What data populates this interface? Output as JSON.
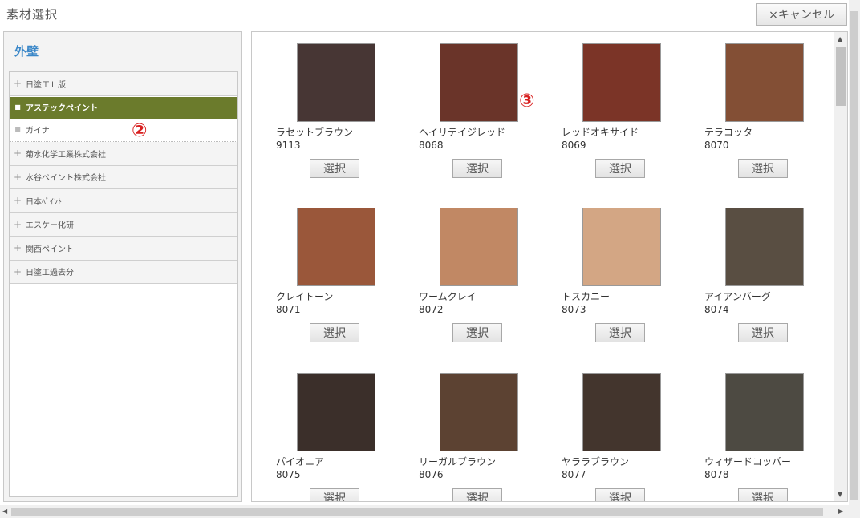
{
  "dialog": {
    "title": "素材選択",
    "cancel_label": "×キャンセル"
  },
  "sidebar": {
    "heading": "外壁",
    "items": [
      {
        "label": "日塗工Ｌ版",
        "marker": "+",
        "state": "collapsed"
      },
      {
        "label": "アステックペイント",
        "marker": "■",
        "state": "active"
      },
      {
        "label": "ガイナ",
        "marker": "■",
        "state": "sub"
      },
      {
        "label": "菊水化学工業株式会社",
        "marker": "+",
        "state": "collapsed"
      },
      {
        "label": "水谷ペイント株式会社",
        "marker": "+",
        "state": "collapsed"
      },
      {
        "label": "日本ﾍﾟｲﾝﾄ",
        "marker": "+",
        "state": "collapsed"
      },
      {
        "label": "エスケー化研",
        "marker": "+",
        "state": "collapsed"
      },
      {
        "label": "関西ペイント",
        "marker": "+",
        "state": "collapsed"
      },
      {
        "label": "日塗工過去分",
        "marker": "+",
        "state": "collapsed"
      }
    ]
  },
  "annotations": {
    "marker_2": "②",
    "marker_3": "③"
  },
  "select_label": "選択",
  "materials": [
    {
      "name": "ラセットブラウン",
      "code": "9113",
      "color": "#473634"
    },
    {
      "name": "ヘイリテイジレッド",
      "code": "8068",
      "color": "#6a3429"
    },
    {
      "name": "レッドオキサイド",
      "code": "8069",
      "color": "#7b3427"
    },
    {
      "name": "テラコッタ",
      "code": "8070",
      "color": "#834f35"
    },
    {
      "name": "クレイトーン",
      "code": "8071",
      "color": "#9a573a"
    },
    {
      "name": "ワームクレイ",
      "code": "8072",
      "color": "#c18864"
    },
    {
      "name": "トスカニー",
      "code": "8073",
      "color": "#d3a684"
    },
    {
      "name": "アイアンバーグ",
      "code": "8074",
      "color": "#594e42"
    },
    {
      "name": "パイオニア",
      "code": "8075",
      "color": "#3b2f2a"
    },
    {
      "name": "リーガルブラウン",
      "code": "8076",
      "color": "#5c4232"
    },
    {
      "name": "ヤララブラウン",
      "code": "8077",
      "color": "#43352d"
    },
    {
      "name": "ウィザードコッパー",
      "code": "8078",
      "color": "#4d4a42"
    }
  ],
  "scroll_arrows": {
    "up": "▲",
    "down": "▼",
    "left": "◀",
    "right": "▶"
  }
}
